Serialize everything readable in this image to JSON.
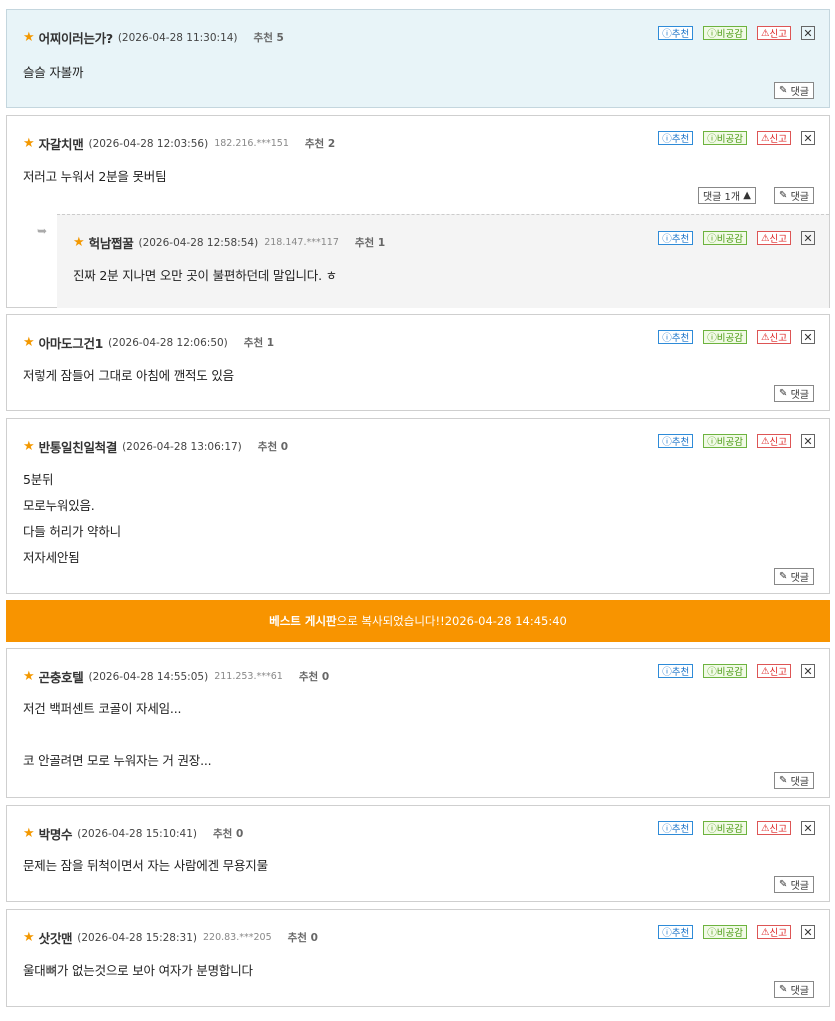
{
  "labels": {
    "recommend": "ⓘ추천",
    "dislike": "ⓘ비공감",
    "report": "신고",
    "reply": "댓글",
    "reply_count": "댓글 1개",
    "banner_board": "베스트 게시판",
    "banner_text": "으로 복사되었습니다!!",
    "banner_time": "2026-04-28 14:45:40"
  },
  "comments": [
    {
      "nick": "어찌이러는가?",
      "date": "(2026-04-28 11:30:14)",
      "ip": "",
      "rec": "추천 5",
      "lines": [
        "슬슬 자볼까"
      ]
    },
    {
      "nick": "자갈치맨",
      "date": "(2026-04-28 12:03:56)",
      "ip": "182.216.***151",
      "rec": "추천 2",
      "lines": [
        "저러고 누워서 2분을 못버팀"
      ]
    },
    {
      "nick": "헉남쩝꿀",
      "date": "(2026-04-28 12:58:54)",
      "ip": "218.147.***117",
      "rec": "추천 1",
      "lines": [
        "진짜 2분 지나면 오만 곳이 불편하던데 말입니다. ㅎ"
      ]
    },
    {
      "nick": "아마도그건1",
      "date": "(2026-04-28 12:06:50)",
      "ip": "",
      "rec": "추천 1",
      "lines": [
        "저렇게 잠들어 그대로 아침에 깬적도 있음"
      ]
    },
    {
      "nick": "반통일친일척결",
      "date": "(2026-04-28 13:06:17)",
      "ip": "",
      "rec": "추천 0",
      "lines": [
        "5분뒤",
        "모로누워있음.",
        "다들 허리가 약하니",
        "저자세안됨"
      ]
    },
    {
      "nick": "곤충호텔",
      "date": "(2026-04-28 14:55:05)",
      "ip": "211.253.***61",
      "rec": "추천 0",
      "lines": [
        "저건 백퍼센트 코골이 자세임...",
        "코 안골려면 모로 누워자는 거 권장..."
      ]
    },
    {
      "nick": "박명수",
      "date": "(2026-04-28 15:10:41)",
      "ip": "",
      "rec": "추천 0",
      "lines": [
        "문제는 잠을 뒤척이면서 자는 사람에겐 무용지물"
      ]
    },
    {
      "nick": "삿갓맨",
      "date": "(2026-04-28 15:28:31)",
      "ip": "220.83.***205",
      "rec": "추천 0",
      "lines": [
        "울대뼈가 없는것으로 보아  여자가 분명합니다"
      ]
    }
  ]
}
